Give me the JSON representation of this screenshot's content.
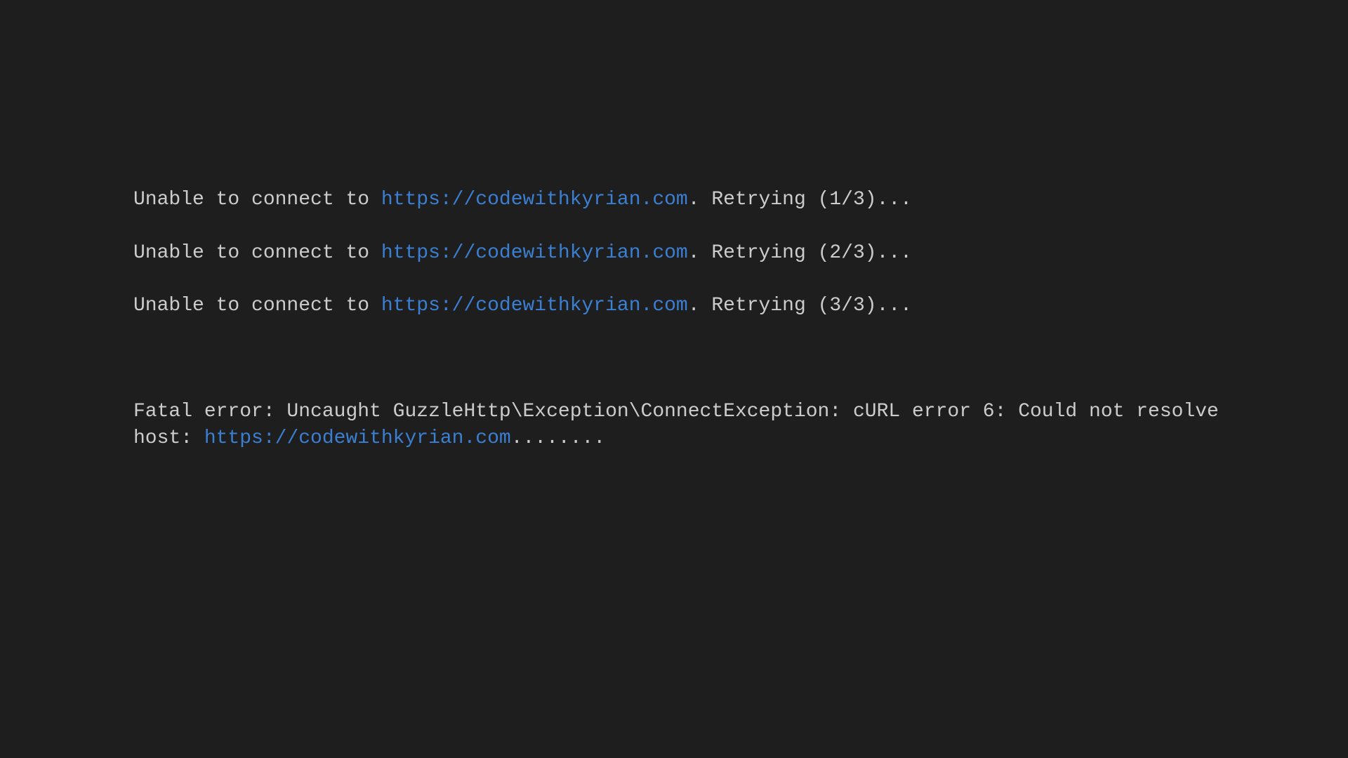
{
  "colors": {
    "background": "#1e1e1e",
    "text": "#cccccc",
    "link": "#3b7fd3"
  },
  "url": "https://codewithkyrian.com",
  "retry_lines": [
    {
      "prefix": "Unable to connect to ",
      "url": "https://codewithkyrian.com",
      "suffix": ". Retrying (1/3)..."
    },
    {
      "prefix": "Unable to connect to ",
      "url": "https://codewithkyrian.com",
      "suffix": ". Retrying (2/3)..."
    },
    {
      "prefix": "Unable to connect to ",
      "url": "https://codewithkyrian.com",
      "suffix": ". Retrying (3/3)..."
    }
  ],
  "fatal_error": {
    "prefix": "Fatal error: Uncaught GuzzleHttp\\Exception\\ConnectException: cURL error 6: Could not resolve host: ",
    "url": "https://codewithkyrian.com",
    "suffix": "........"
  }
}
